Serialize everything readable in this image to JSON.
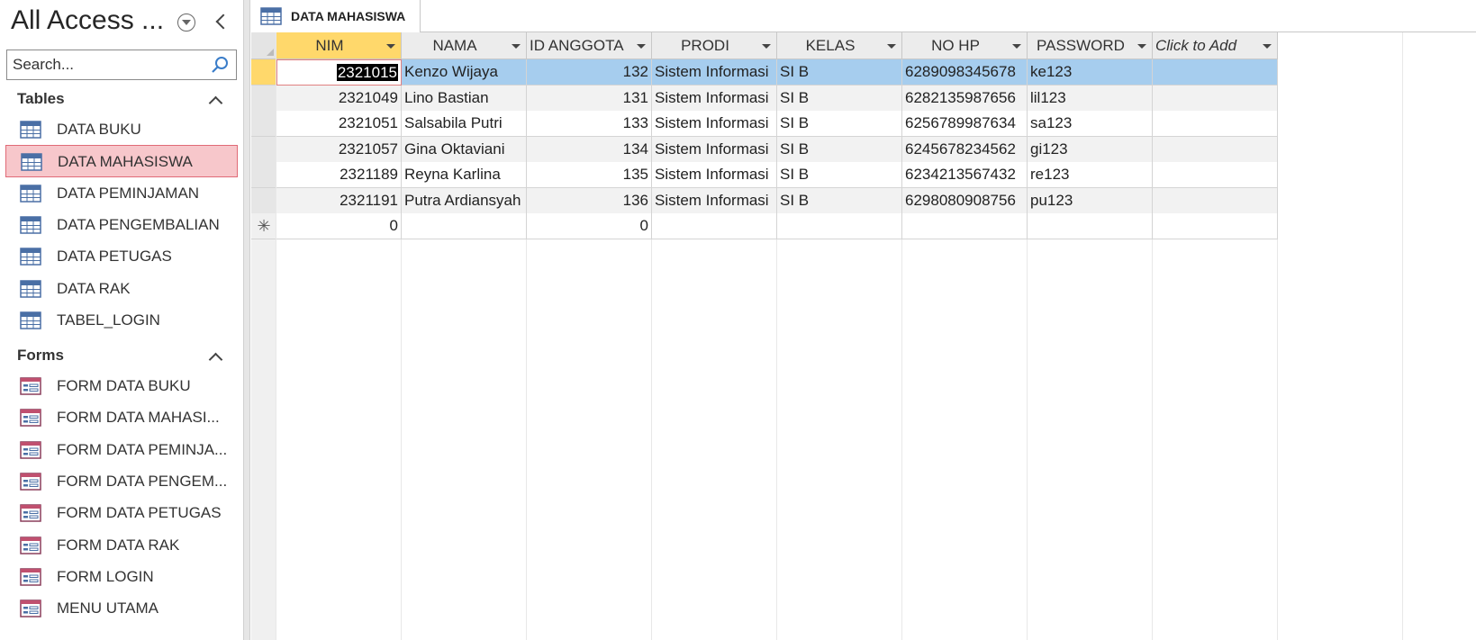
{
  "nav": {
    "title": "All Access ...",
    "search_placeholder": "Search...",
    "groups": [
      {
        "label": "Tables",
        "items": [
          {
            "label": "DATA BUKU",
            "selected": false
          },
          {
            "label": "DATA MAHASISWA",
            "selected": true
          },
          {
            "label": "DATA PEMINJAMAN",
            "selected": false
          },
          {
            "label": "DATA PENGEMBALIAN",
            "selected": false
          },
          {
            "label": "DATA PETUGAS",
            "selected": false
          },
          {
            "label": "DATA RAK",
            "selected": false
          },
          {
            "label": "TABEL_LOGIN",
            "selected": false
          }
        ]
      },
      {
        "label": "Forms",
        "items": [
          {
            "label": "FORM DATA BUKU"
          },
          {
            "label": "FORM DATA MAHASI..."
          },
          {
            "label": "FORM DATA PEMINJA..."
          },
          {
            "label": "FORM DATA PENGEM..."
          },
          {
            "label": "FORM DATA PETUGAS"
          },
          {
            "label": "FORM DATA RAK"
          },
          {
            "label": "FORM LOGIN"
          },
          {
            "label": "MENU UTAMA"
          }
        ]
      }
    ]
  },
  "tab": {
    "label": "DATA MAHASISWA"
  },
  "grid": {
    "columns": [
      "NIM",
      "NAMA",
      "ID ANGGOTA",
      "PRODI",
      "KELAS",
      "NO HP",
      "PASSWORD",
      "Click to Add"
    ],
    "rows": [
      [
        "2321015",
        "Kenzo Wijaya",
        "132",
        "Sistem Informasi",
        "SI B",
        "6289098345678",
        "ke123",
        ""
      ],
      [
        "2321049",
        "Lino Bastian",
        "131",
        "Sistem Informasi",
        "SI B",
        "6282135987656",
        "lil123",
        ""
      ],
      [
        "2321051",
        "Salsabila Putri",
        "133",
        "Sistem Informasi",
        "SI B",
        "6256789987634",
        "sa123",
        ""
      ],
      [
        "2321057",
        "Gina Oktaviani",
        "134",
        "Sistem Informasi",
        "SI B",
        "6245678234562",
        "gi123",
        ""
      ],
      [
        "2321189",
        "Reyna Karlina",
        "135",
        "Sistem Informasi",
        "SI B",
        "6234213567432",
        "re123",
        ""
      ],
      [
        "2321191",
        "Putra Ardiansyah",
        "136",
        "Sistem Informasi",
        "SI B",
        "6298080908756",
        "pu123",
        ""
      ]
    ],
    "new_record": [
      "0",
      "",
      "0",
      "",
      "",
      "",
      "",
      ""
    ],
    "new_record_marker": "✳",
    "selected_row": 0
  },
  "colors": {
    "selected_nav_bg": "#f7c7cb",
    "selected_row_bg": "#a6cdee",
    "active_header_bg": "#ffd86b"
  }
}
